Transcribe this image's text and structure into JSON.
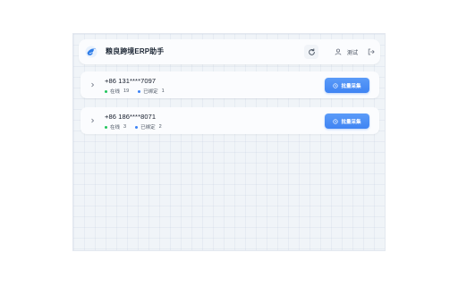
{
  "header": {
    "title": "粮良跨境ERP助手",
    "logo_icon": "bird-logo-icon",
    "refresh_icon": "refresh-icon",
    "user_icon": "user-icon",
    "user_name": "测试",
    "logout_icon": "logout-icon"
  },
  "colors": {
    "accent": "#3f84f3",
    "online_dot": "#22c55e",
    "bound_dot": "#3b82f6",
    "background": "#f0f4f8"
  },
  "accounts": [
    {
      "phone": "+86 131****7097",
      "online_label": "在线",
      "online_count": "19",
      "bound_label": "已绑定",
      "bound_count": "1",
      "button_label": "批量采集"
    },
    {
      "phone": "+86 186****8071",
      "online_label": "在线",
      "online_count": "3",
      "bound_label": "已绑定",
      "bound_count": "2",
      "button_label": "批量采集"
    }
  ]
}
